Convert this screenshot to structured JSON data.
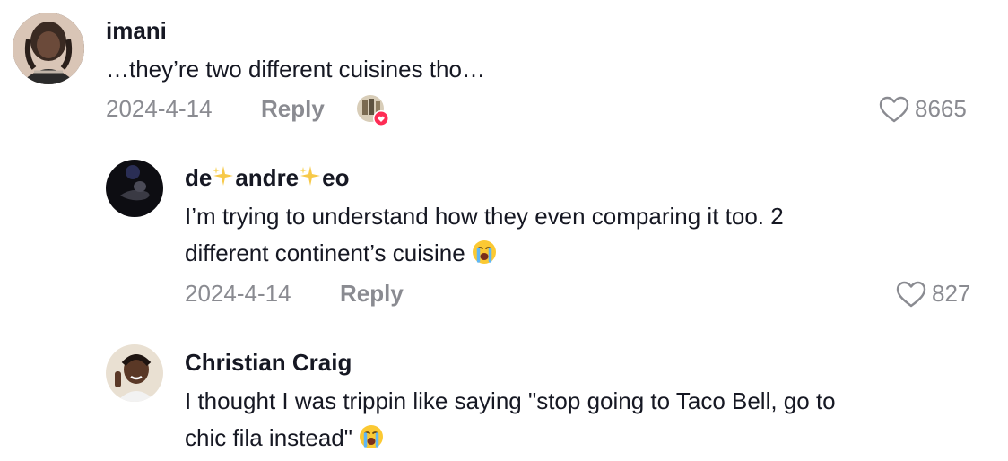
{
  "comments": [
    {
      "username": "imani",
      "text": "…they’re two different cuisines tho…",
      "date": "2024-4-14",
      "reply_label": "Reply",
      "likes": "8665",
      "creator_liked": true
    },
    {
      "username_parts": [
        "de",
        "andre",
        "eo"
      ],
      "text_line1": "I’m trying to understand how they even comparing it too. 2",
      "text_line2": "different continent’s cuisine",
      "date": "2024-4-14",
      "reply_label": "Reply",
      "likes": "827"
    },
    {
      "username": "Christian Craig",
      "text_line1": "I thought I was trippin like saying \"stop going to Taco Bell, go to",
      "text_line2": "chic fila instead\""
    }
  ],
  "colors": {
    "text": "#161823",
    "muted": "#8a8b91",
    "heart_badge": "#fe2c55"
  },
  "icons": {
    "like": "heart-outline-icon",
    "crying": "loudly-crying-face-emoji",
    "sparkles": "sparkles-emoji"
  }
}
